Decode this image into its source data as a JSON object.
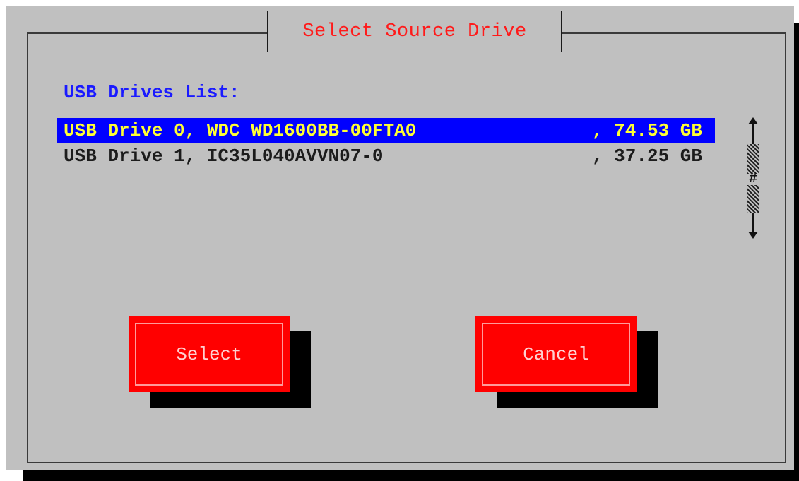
{
  "dialog": {
    "title": "Select Source Drive",
    "list_label": "USB Drives List:"
  },
  "drives": [
    {
      "name": "USB Drive 0, WDC WD1600BB-00FTA0",
      "size": ", 74.53 GB",
      "selected": true
    },
    {
      "name": "USB Drive 1, IC35L040AVVN07-0",
      "size": ", 37.25 GB",
      "selected": false
    }
  ],
  "scrollbar": {
    "thumb_glyph": "#"
  },
  "buttons": {
    "select_label": "Select",
    "cancel_label": "Cancel"
  },
  "colors": {
    "background": "#c0c0c0",
    "title": "#ff1a1a",
    "list_label": "#1a1aff",
    "selection_bg": "#0000ff",
    "selection_fg": "#ffff33",
    "button_bg": "#ff0000"
  }
}
